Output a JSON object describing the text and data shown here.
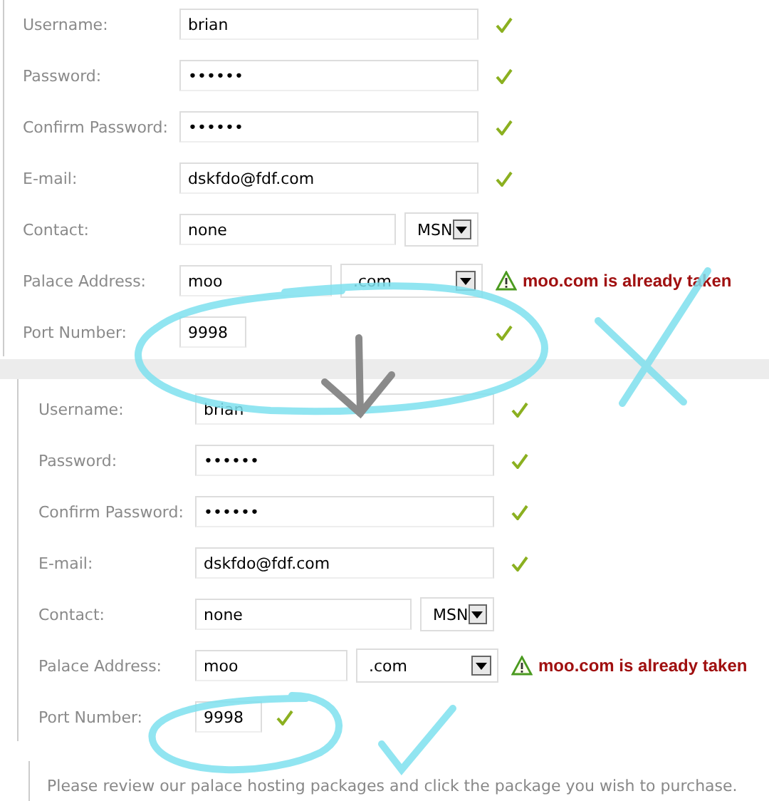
{
  "forms": [
    {
      "rows": [
        {
          "label": "Username:",
          "kind": "text",
          "value": "brian",
          "valid": true
        },
        {
          "label": "Password:",
          "kind": "text",
          "value": "••••••",
          "valid": true
        },
        {
          "label": "Confirm Password:",
          "kind": "text",
          "value": "••••••",
          "valid": true
        },
        {
          "label": "E-mail:",
          "kind": "text",
          "value": "dskfdo@fdf.com",
          "valid": true
        },
        {
          "label": "Contact:",
          "kind": "contact",
          "value": "none",
          "select": "MSN"
        },
        {
          "label": "Palace Address:",
          "kind": "address",
          "value": "moo",
          "select": ".com",
          "message": "moo.com is already taken"
        },
        {
          "label": "Port Number:",
          "kind": "port",
          "value": "9998",
          "valid": true
        }
      ]
    },
    {
      "rows": [
        {
          "label": "Username:",
          "kind": "text",
          "value": "brian",
          "valid": true
        },
        {
          "label": "Password:",
          "kind": "text",
          "value": "••••••",
          "valid": true
        },
        {
          "label": "Confirm Password:",
          "kind": "text",
          "value": "••••••",
          "valid": true
        },
        {
          "label": "E-mail:",
          "kind": "text",
          "value": "dskfdo@fdf.com",
          "valid": true
        },
        {
          "label": "Contact:",
          "kind": "contact",
          "value": "none",
          "select": "MSN"
        },
        {
          "label": "Palace Address:",
          "kind": "address",
          "value": "moo",
          "select": ".com",
          "message": "moo.com is already taken"
        },
        {
          "label": "Port Number:",
          "kind": "port-inline",
          "value": "9998",
          "valid": true
        }
      ]
    }
  ],
  "footer": "Please review our palace hosting packages and click the package you wish to purchase."
}
